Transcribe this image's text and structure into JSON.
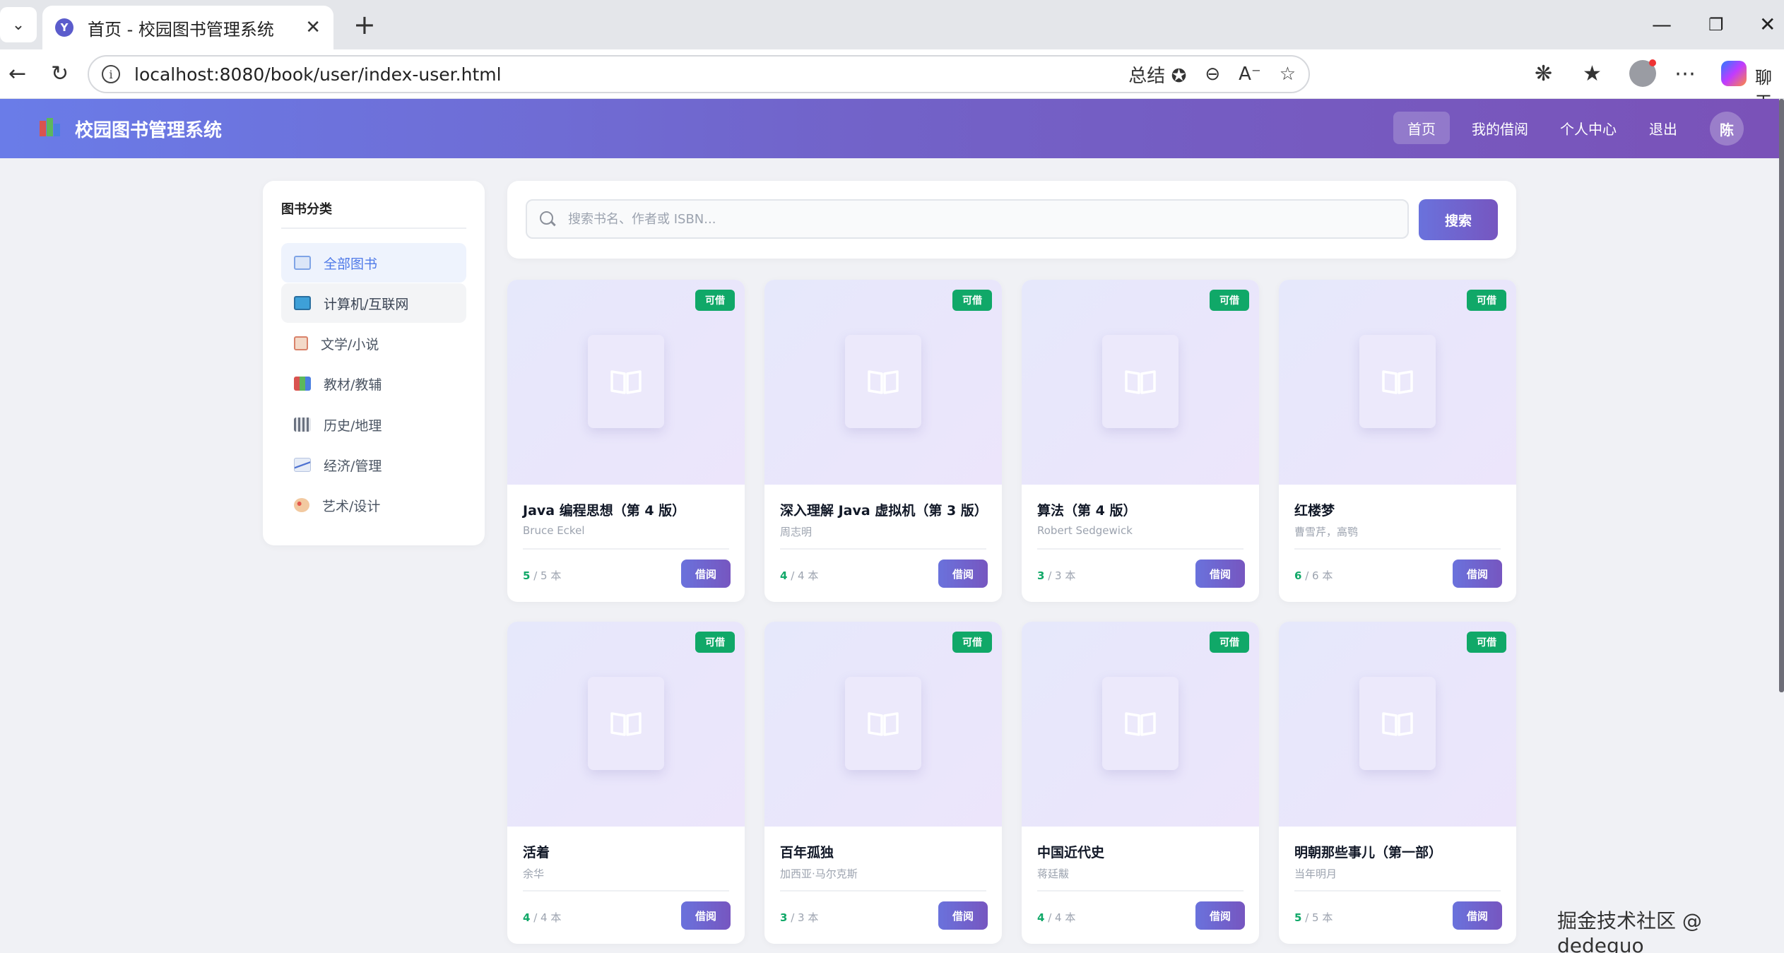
{
  "browser": {
    "tab_title": "首页 - 校园图书管理系统",
    "favicon_letter": "Y",
    "url": "localhost:8080/book/user/index-user.html",
    "summarize_label": "总结",
    "chat_label": "聊天"
  },
  "app": {
    "title": "校园图书管理系统",
    "nav": [
      "首页",
      "我的借阅",
      "个人中心",
      "退出"
    ],
    "user_initial": "陈"
  },
  "sidebar": {
    "title": "图书分类",
    "items": [
      {
        "label": "全部图书",
        "icon": "open-book-icon"
      },
      {
        "label": "计算机/互联网",
        "icon": "computer-icon"
      },
      {
        "label": "文学/小说",
        "icon": "memo-icon"
      },
      {
        "label": "教材/教辅",
        "icon": "books-icon"
      },
      {
        "label": "历史/地理",
        "icon": "classical-building-icon"
      },
      {
        "label": "经济/管理",
        "icon": "chart-icon"
      },
      {
        "label": "艺术/设计",
        "icon": "palette-icon"
      }
    ]
  },
  "search": {
    "placeholder": "搜索书名、作者或 ISBN...",
    "button": "搜索"
  },
  "books": [
    {
      "title": "Java 编程思想（第 4 版）",
      "author": "Bruce Eckel",
      "available": "5",
      "total": "/ 5 本",
      "status": "可借",
      "action": "借阅"
    },
    {
      "title": "深入理解 Java 虚拟机（第 3 版）",
      "author": "周志明",
      "available": "4",
      "total": "/ 4 本",
      "status": "可借",
      "action": "借阅"
    },
    {
      "title": "算法（第 4 版）",
      "author": "Robert Sedgewick",
      "available": "3",
      "total": "/ 3 本",
      "status": "可借",
      "action": "借阅"
    },
    {
      "title": "红楼梦",
      "author": "曹雪芹，高鹗",
      "available": "6",
      "total": "/ 6 本",
      "status": "可借",
      "action": "借阅"
    },
    {
      "title": "活着",
      "author": "余华",
      "available": "4",
      "total": "/ 4 本",
      "status": "可借",
      "action": "借阅"
    },
    {
      "title": "百年孤独",
      "author": "加西亚·马尔克斯",
      "available": "3",
      "total": "/ 3 本",
      "status": "可借",
      "action": "借阅"
    },
    {
      "title": "中国近代史",
      "author": "蒋廷黻",
      "available": "4",
      "total": "/ 4 本",
      "status": "可借",
      "action": "借阅"
    },
    {
      "title": "明朝那些事儿（第一部）",
      "author": "当年明月",
      "available": "5",
      "total": "/ 5 本",
      "status": "可借",
      "action": "借阅"
    }
  ],
  "watermark": "掘金技术社区 @ dedeguo"
}
